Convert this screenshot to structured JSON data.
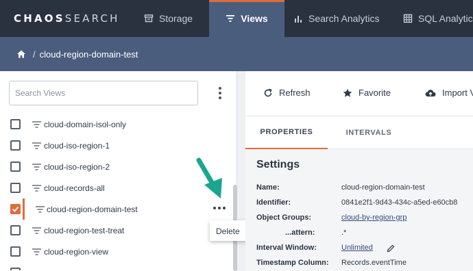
{
  "app": {
    "logo_bold": "CHAOS",
    "logo_light": "SEARCH"
  },
  "nav": {
    "tabs": [
      {
        "label": "Storage",
        "icon": "storage-icon"
      },
      {
        "label": "Views",
        "icon": "filter-icon",
        "active": true
      },
      {
        "label": "Search Analytics",
        "icon": "bar-chart-icon"
      },
      {
        "label": "SQL Analytics",
        "icon": "grid-icon"
      }
    ]
  },
  "breadcrumb": {
    "separator": "/",
    "current": "cloud-region-domain-test"
  },
  "sidebar": {
    "search_placeholder": "Search Views",
    "items": [
      {
        "label": "cloud-domain-isol-only",
        "checked": false
      },
      {
        "label": "cloud-iso-region-1",
        "checked": false
      },
      {
        "label": "cloud-iso-region-2",
        "checked": false
      },
      {
        "label": "cloud-records-all",
        "checked": false
      },
      {
        "label": "cloud-region-domain-test",
        "checked": true
      },
      {
        "label": "cloud-region-test-treat",
        "checked": false
      },
      {
        "label": "cloud-region-view",
        "checked": false
      }
    ],
    "context_menu": {
      "delete_label": "Delete"
    }
  },
  "toolbar": {
    "refresh_label": "Refresh",
    "favorite_label": "Favorite",
    "import_label": "Import V"
  },
  "tabs": {
    "properties": "PROPERTIES",
    "intervals": "INTERVALS"
  },
  "settings": {
    "title": "Settings",
    "name_key": "Name:",
    "name_value": "cloud-region-domain-test",
    "identifier_key": "Identifier:",
    "identifier_value": "0841e2f1-9d43-434c-a5ed-e60cb8",
    "object_groups_key": "Object Groups:",
    "object_groups_value": "cloud-by-region-grp",
    "pattern_key": "...attern:",
    "pattern_value": ".*",
    "interval_key": "Interval Window:",
    "interval_value": "Unlimited",
    "timestamp_key": "Timestamp Column:",
    "timestamp_value": "Records.eventTime"
  },
  "colors": {
    "accent": "#e06c3a",
    "nav_bg": "#2a3240",
    "nav_active": "#4a5d7d",
    "arrow": "#1aa58f"
  }
}
